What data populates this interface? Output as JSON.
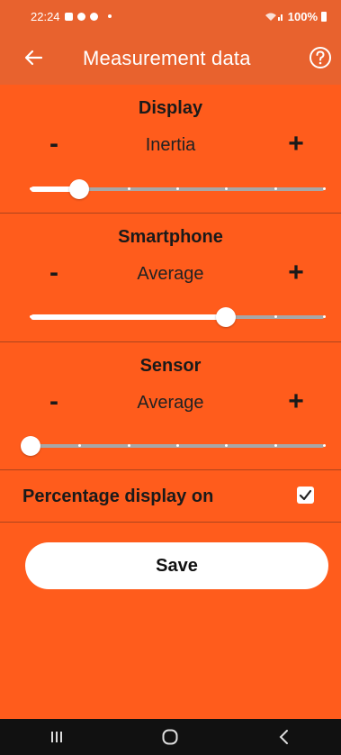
{
  "status_bar": {
    "time": "22:24",
    "battery": "100%"
  },
  "app_bar": {
    "title": "Measurement data",
    "back_icon": "arrow-left-icon",
    "help_icon": "help-circle-icon"
  },
  "sections": [
    {
      "title": "Display",
      "value": "Inertia",
      "minus": "-",
      "plus": "+",
      "slider": {
        "steps": 7,
        "position": 1
      }
    },
    {
      "title": "Smartphone",
      "value": "Average",
      "minus": "-",
      "plus": "+",
      "slider": {
        "steps": 7,
        "position": 4
      }
    },
    {
      "title": "Sensor",
      "value": "Average",
      "minus": "-",
      "plus": "+",
      "slider": {
        "steps": 7,
        "position": 0
      }
    }
  ],
  "percentage_display": {
    "label": "Percentage display on",
    "checked": true
  },
  "save_button": {
    "label": "Save"
  },
  "colors": {
    "background": "#ff5c1c",
    "app_bar": "#e8622e",
    "track": "#a7a7a7",
    "thumb": "#ffffff"
  }
}
